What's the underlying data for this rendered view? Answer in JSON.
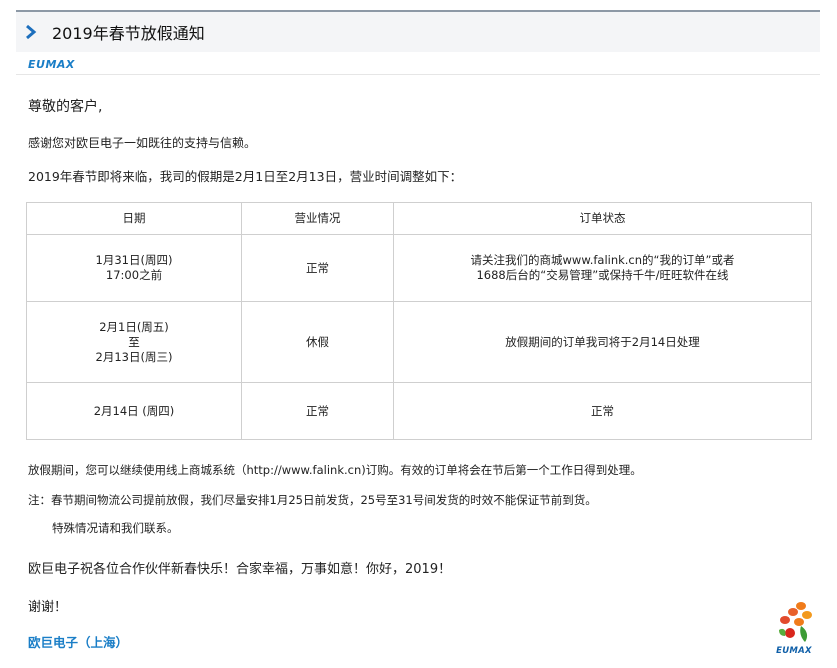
{
  "header": {
    "title": "2019年春节放假通知",
    "icon": "chevron-right-icon"
  },
  "brand": {
    "name": "EUMAX",
    "accent": "#1a7ec7"
  },
  "greeting": "尊敬的客户,",
  "thanks": "感谢您对欧巨电子一如既往的支持与信赖。",
  "intro": "2019年春节即将来临，我司的假期是2月1日至2月13日，营业时间调整如下：",
  "table": {
    "headers": [
      "日期",
      "营业情况",
      "订单状态"
    ],
    "rows": [
      {
        "date": [
          "1月31日(周四)",
          "17:00之前"
        ],
        "status": "正常",
        "order": [
          "请关注我们的商城www.falink.cn的“我的订单”或者",
          "1688后台的“交易管理”或保持千牛/旺旺软件在线"
        ]
      },
      {
        "date": [
          "2月1日(周五)",
          "至",
          "2月13日(周三)"
        ],
        "status": "休假",
        "order": [
          "放假期间的订单我司将于2月14日处理"
        ]
      },
      {
        "date": [
          "2月14日 (周四)"
        ],
        "status": "正常",
        "order": [
          "正常"
        ]
      }
    ]
  },
  "notes": [
    "放假期间，您可以继续使用线上商城系统（http://www.falink.cn)订购。有效的订单将会在节后第一个工作日得到处理。",
    "注：春节期间物流公司提前放假，我们尽量安排1月25日前发货，25号至31号间发货的时效不能保证节前到货。",
    "特殊情况请和我们联系。"
  ],
  "wish": "欧巨电子祝各位合作伙伴新春快乐！合家幸福，万事如意！你好，2019！",
  "closing": "谢谢！",
  "signature": "欧巨电子（上海）",
  "logo": {
    "text": "EUMAX",
    "icon": "flower-logo-icon"
  }
}
